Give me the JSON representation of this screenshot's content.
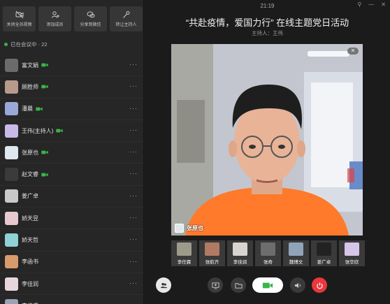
{
  "actions": [
    {
      "label": "关闭全员视频",
      "icon": "video-off-icon"
    },
    {
      "label": "添加成员",
      "icon": "add-member-icon"
    },
    {
      "label": "分享到微信",
      "icon": "wechat-share-icon"
    },
    {
      "label": "转让主持人",
      "icon": "transfer-host-icon"
    }
  ],
  "online_label": "已在会议中 · 22",
  "participants": [
    {
      "name": "富文娟",
      "camera": true,
      "color": "#6b6b6b"
    },
    {
      "name": "顾胜师",
      "camera": true,
      "color": "#b89a8a"
    },
    {
      "name": "潘晨",
      "camera": true,
      "color": "#9aa8d8"
    },
    {
      "name": "王伟(主持人)",
      "camera": true,
      "color": "#c7b9e8"
    },
    {
      "name": "张原也",
      "camera": true,
      "color": "#dfe8ef"
    },
    {
      "name": "赵文睿",
      "camera": true,
      "color": "#3b3b3b"
    },
    {
      "name": "姜广卓",
      "camera": false,
      "color": "#c9c9c9"
    },
    {
      "name": "娇天昱",
      "camera": false,
      "color": "#e8c9cf"
    },
    {
      "name": "娇天哲",
      "camera": false,
      "color": "#8fd1d6"
    },
    {
      "name": "李函书",
      "camera": false,
      "color": "#d99a6c"
    },
    {
      "name": "李佳润",
      "camera": false,
      "color": "#e7d7dc"
    },
    {
      "name": "李佳睿",
      "camera": false,
      "color": "#9aa3b5"
    }
  ],
  "clock": "21:19",
  "meeting_title": "“共赴疫情，爱国力行” 在线主题党日活动",
  "host_label": "主持人：王伟",
  "main_video": {
    "speaker": "张原也",
    "close": "✕"
  },
  "thumbnails": [
    {
      "name": "李任霖",
      "color": "#9c9a8a"
    },
    {
      "name": "张航齐",
      "color": "#b07a65"
    },
    {
      "name": "李佳润",
      "color": "#d8d4cf"
    },
    {
      "name": "张奇",
      "color": "#6d6d6d"
    },
    {
      "name": "魏博文",
      "color": "#8fa4b8"
    },
    {
      "name": "姜广卓",
      "color": "#222222"
    },
    {
      "name": "张华欣",
      "color": "#d7c6e6"
    }
  ],
  "top_icons": [
    "pin-icon",
    "minimize-icon",
    "close-icon"
  ],
  "colors": {
    "accent_green": "#39b54a",
    "hangup_red": "#e9373d"
  }
}
